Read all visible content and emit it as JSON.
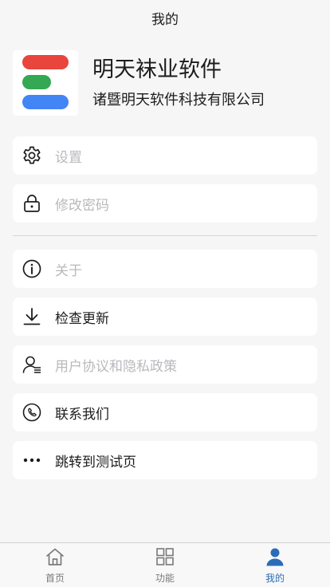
{
  "header": {
    "title": "我的"
  },
  "profile": {
    "app_name": "明天袜业软件",
    "company": "诸暨明天软件科技有限公司",
    "logo_colors": [
      "#e8453c",
      "#34a853",
      "#4285f4"
    ]
  },
  "menu": {
    "settings": {
      "label": "设置",
      "icon": "gear-icon",
      "enabled": false
    },
    "change_password": {
      "label": "修改密码",
      "icon": "lock-icon",
      "enabled": false
    },
    "about": {
      "label": "关于",
      "icon": "info-icon",
      "enabled": false
    },
    "check_update": {
      "label": "检查更新",
      "icon": "download-icon",
      "enabled": true
    },
    "user_agreement": {
      "label": "用户协议和隐私政策",
      "icon": "user-doc-icon",
      "enabled": false
    },
    "contact_us": {
      "label": "联系我们",
      "icon": "phone-icon",
      "enabled": true
    },
    "test_page": {
      "label": "跳转到测试页",
      "icon": "more-dots-icon",
      "enabled": true
    }
  },
  "tabbar": {
    "home": {
      "label": "首页",
      "icon": "home-icon"
    },
    "functions": {
      "label": "功能",
      "icon": "grid-icon"
    },
    "mine": {
      "label": "我的",
      "icon": "person-icon",
      "active": true
    }
  },
  "colors": {
    "accent": "#2b6cb8",
    "disabled_text": "#b9b9be",
    "background": "#f6f6f7"
  }
}
